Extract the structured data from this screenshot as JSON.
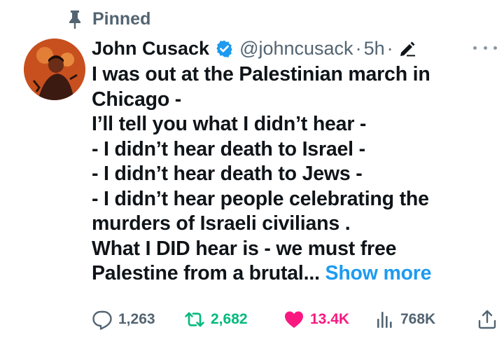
{
  "pinned": {
    "label": "Pinned",
    "icon": "pin-icon"
  },
  "author": {
    "display_name": "John Cusack",
    "handle": "@johncusack",
    "separator": "·",
    "timestamp": "5h",
    "verified_icon": "verified-badge-icon",
    "verified_color": "#1d9bf0",
    "edit_icon": "edit-pencil-icon"
  },
  "tweet": {
    "lines": [
      "I was out at the Palestinian march in",
      "Chicago -",
      "I’ll tell you what I didn’t hear -",
      "- I didn’t hear death to  Israel -",
      "- I didn’t hear death to Jews -",
      "- I didn’t hear people celebrating the",
      "murders of Israeli civilians .",
      "What I DID hear is - we must free",
      "Palestine from a brutal..."
    ],
    "show_more": "Show more",
    "link_color": "#1d9bf0"
  },
  "actions": {
    "reply": {
      "count": "1,263",
      "icon": "reply-icon"
    },
    "retweet": {
      "count": "2,682",
      "icon": "retweet-icon",
      "color": "#00ba7c"
    },
    "like": {
      "count": "13.4K",
      "icon": "heart-icon",
      "color": "#f91880"
    },
    "views": {
      "count": "768K",
      "icon": "views-chart-icon"
    },
    "share": {
      "icon": "share-icon"
    }
  },
  "more_icon": "more-options-icon"
}
